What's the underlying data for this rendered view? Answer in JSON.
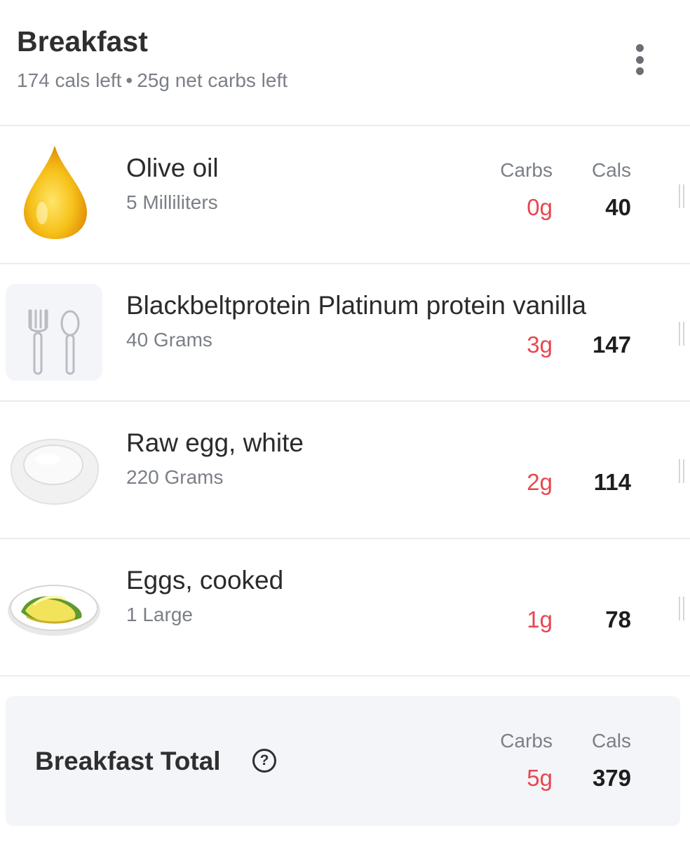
{
  "header": {
    "title": "Breakfast",
    "cals_left": "174 cals left",
    "separator": "•",
    "carbs_left": "25g net carbs left"
  },
  "columns": {
    "carbs": "Carbs",
    "cals": "Cals"
  },
  "items": [
    {
      "name": "Olive oil",
      "quantity": "5 Milliliters",
      "carbs": "0g",
      "cals": "40",
      "icon": "olive-oil-drop-icon"
    },
    {
      "name": "Blackbeltprotein Platinum protein vanilla",
      "quantity": "40 Grams",
      "carbs": "3g",
      "cals": "147",
      "icon": "fork-spoon-icon"
    },
    {
      "name": "Raw egg, white",
      "quantity": "220 Grams",
      "carbs": "2g",
      "cals": "114",
      "icon": "egg-white-icon"
    },
    {
      "name": "Eggs, cooked",
      "quantity": "1 Large",
      "carbs": "1g",
      "cals": "78",
      "icon": "cooked-eggs-plate-icon"
    }
  ],
  "total": {
    "label": "Breakfast Total",
    "help": "?",
    "carbs": "5g",
    "cals": "379"
  },
  "colors": {
    "carbs_red": "#e8474f",
    "muted_text": "#7b7f86",
    "divider": "#ececec",
    "total_bg": "#f4f5f9"
  }
}
